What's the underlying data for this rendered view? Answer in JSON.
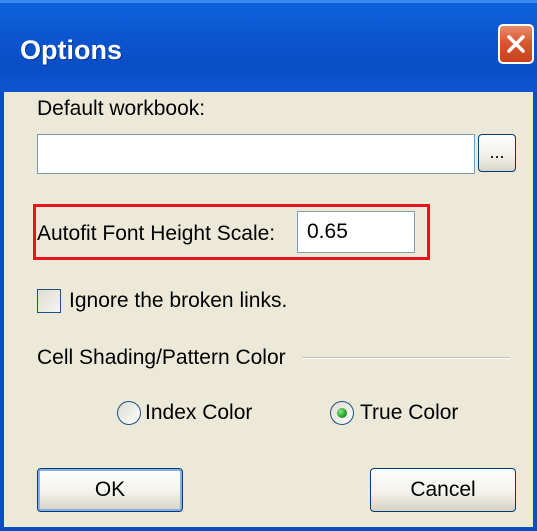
{
  "window": {
    "title": "Options",
    "close_icon": "close-icon"
  },
  "default_workbook": {
    "label": "Default workbook:",
    "value": "",
    "browse_label": "..."
  },
  "autofit": {
    "label": "Autofit Font Height Scale:",
    "value": "0.65"
  },
  "ignore_links": {
    "label": "Ignore the broken links.",
    "checked": false
  },
  "cell_shading": {
    "group_label": "Cell Shading/Pattern Color",
    "options": [
      {
        "label": "Index Color",
        "selected": false
      },
      {
        "label": "True Color",
        "selected": true
      }
    ]
  },
  "buttons": {
    "ok_label": "OK",
    "cancel_label": "Cancel"
  },
  "colors": {
    "titlebar": "#0a4ec7",
    "dialog_bg": "#ece9d8",
    "highlight_box": "#e8141c",
    "close_button": "#d9572f"
  }
}
